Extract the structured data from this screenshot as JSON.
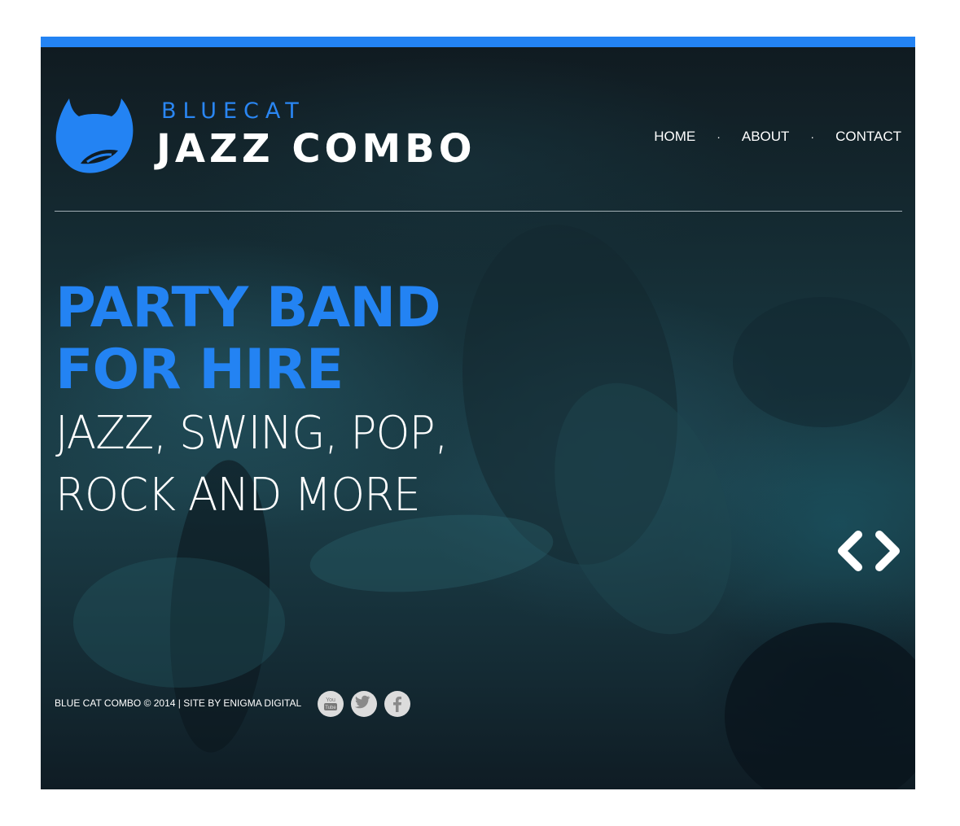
{
  "brand": {
    "line1": "BLUECAT",
    "line2": "JAZZ COMBO",
    "logo_icon": "cat-head-icon",
    "accent_color": "#2383f3"
  },
  "nav": {
    "items": [
      {
        "label": "HOME"
      },
      {
        "label": "ABOUT"
      },
      {
        "label": "CONTACT"
      }
    ],
    "separator": "·"
  },
  "hero": {
    "headline_line1": "PARTY BAND",
    "headline_line2": "FOR HIRE",
    "sub_line1": "JAZZ, SWING, POP,",
    "sub_line2": "ROCK AND MORE"
  },
  "slider": {
    "prev_icon": "chevron-left-icon",
    "next_icon": "chevron-right-icon"
  },
  "footer": {
    "credit": "BLUE CAT COMBO © 2014 | SITE BY ENIGMA DIGITAL",
    "social": [
      {
        "name": "youtube-icon"
      },
      {
        "name": "twitter-icon"
      },
      {
        "name": "facebook-icon"
      }
    ]
  }
}
